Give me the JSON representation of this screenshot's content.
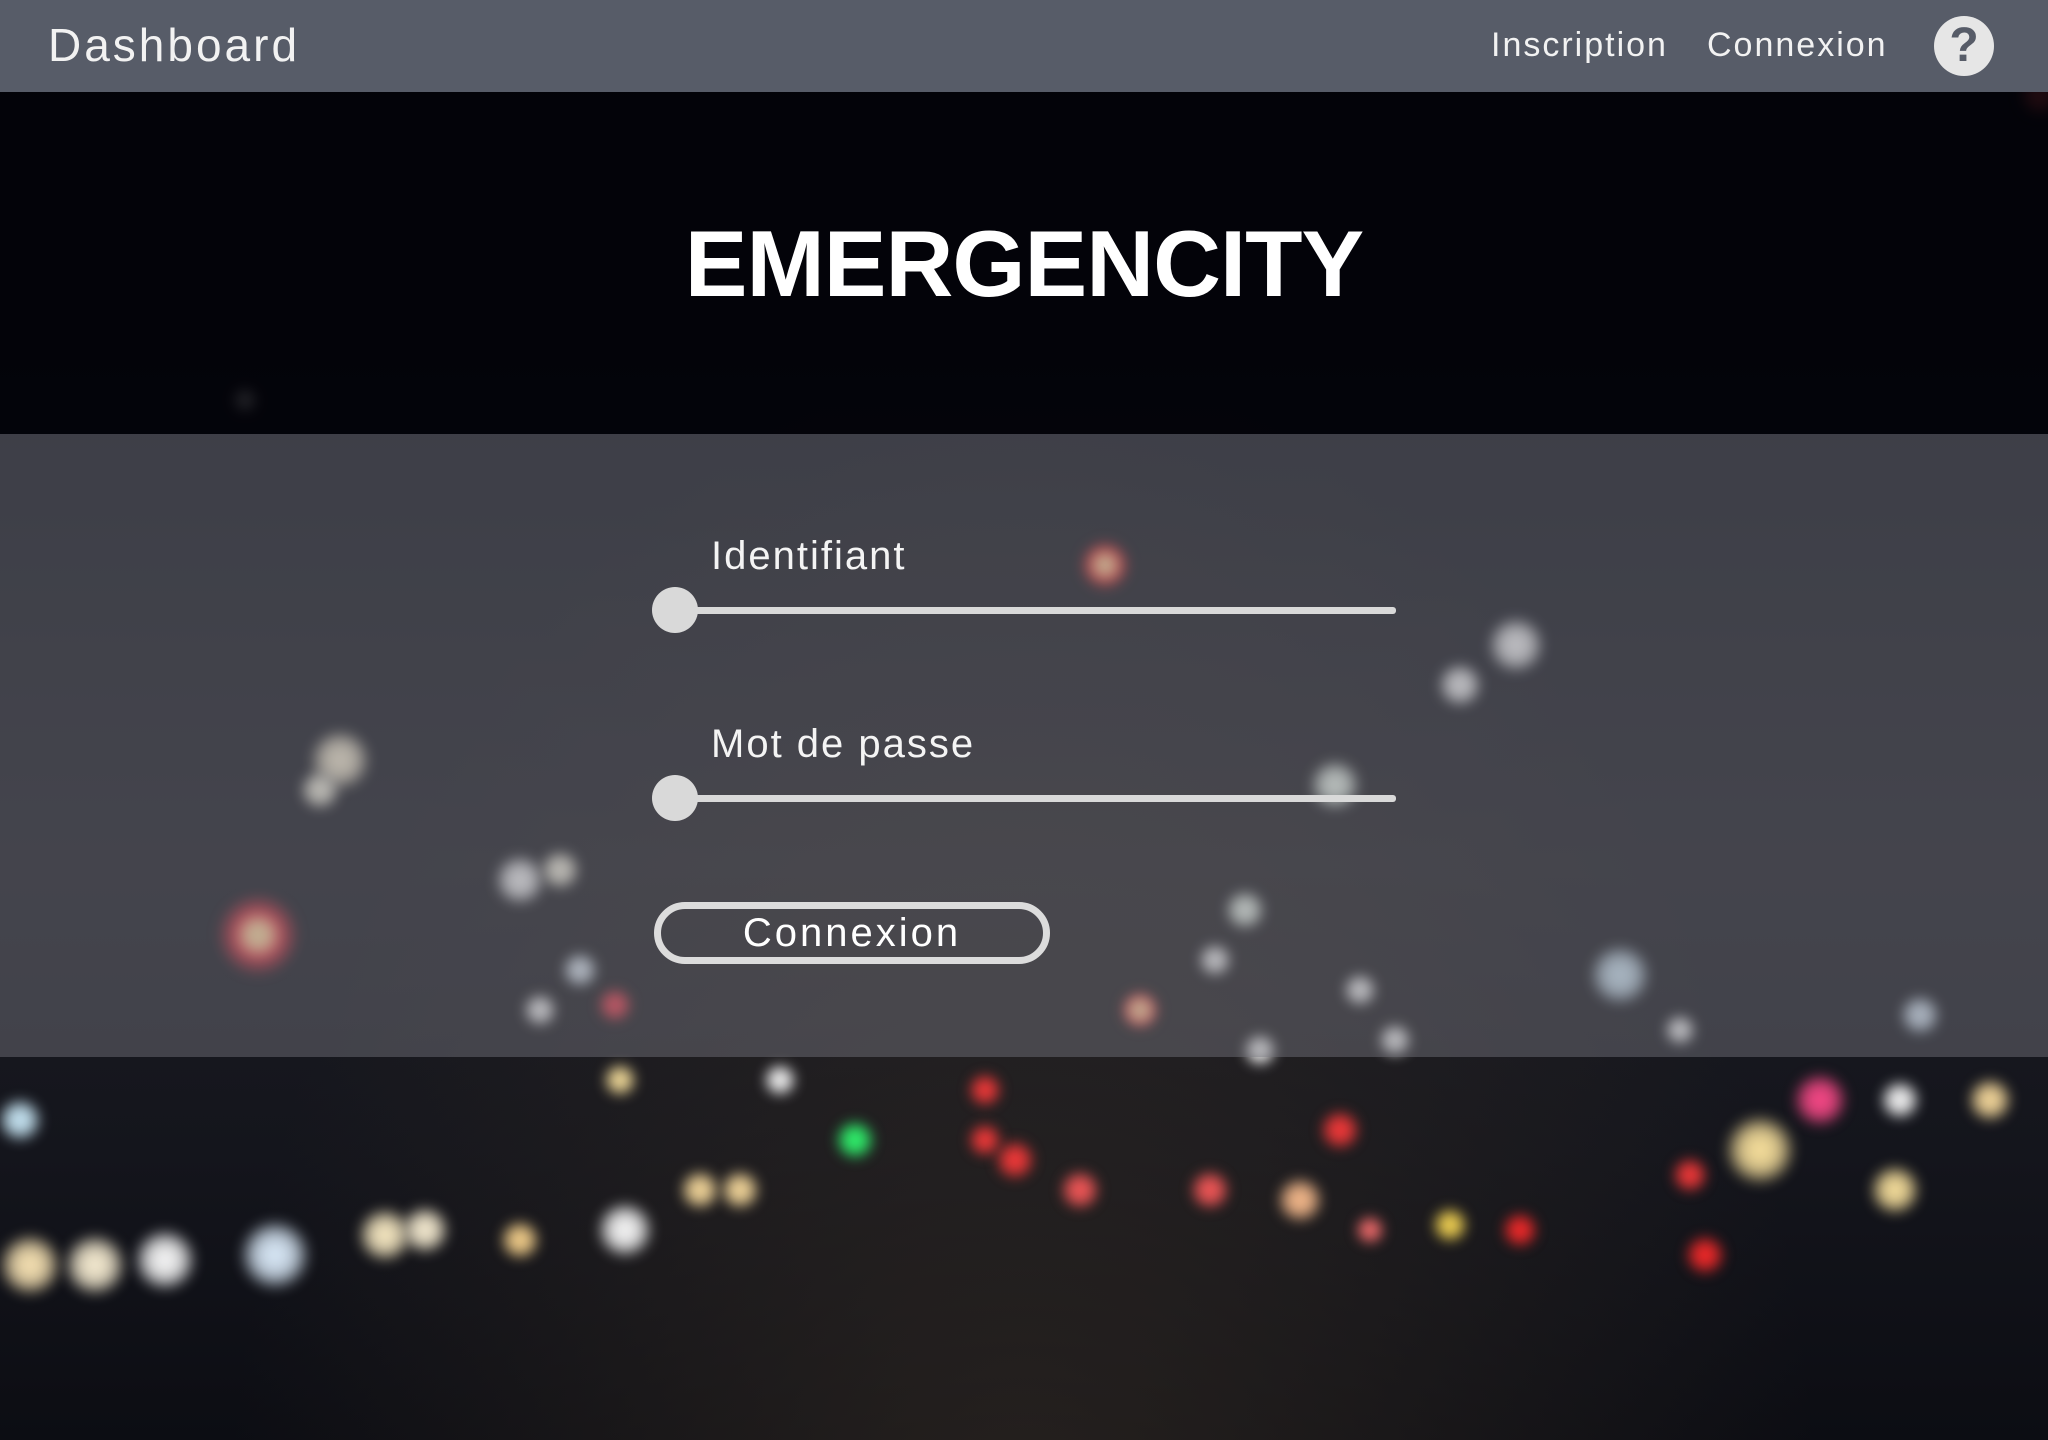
{
  "topbar": {
    "brand": "Dashboard",
    "links": {
      "inscription": "Inscription",
      "connexion": "Connexion"
    },
    "help_symbol": "?",
    "help_icon": "question-mark-icon"
  },
  "hero": {
    "title": "EMERGENCITY"
  },
  "login_form": {
    "username_label": "Identifiant",
    "username_value": "",
    "password_label": "Mot de passe",
    "password_value": "",
    "submit_label": "Connexion"
  },
  "colors": {
    "topbar": "#575c68",
    "hero_band": "#020208",
    "panel": "#78787f",
    "field_line": "#d9d9d9",
    "text": "#ffffff"
  },
  "background": {
    "description_icon": "night-city-bokeh-background"
  }
}
